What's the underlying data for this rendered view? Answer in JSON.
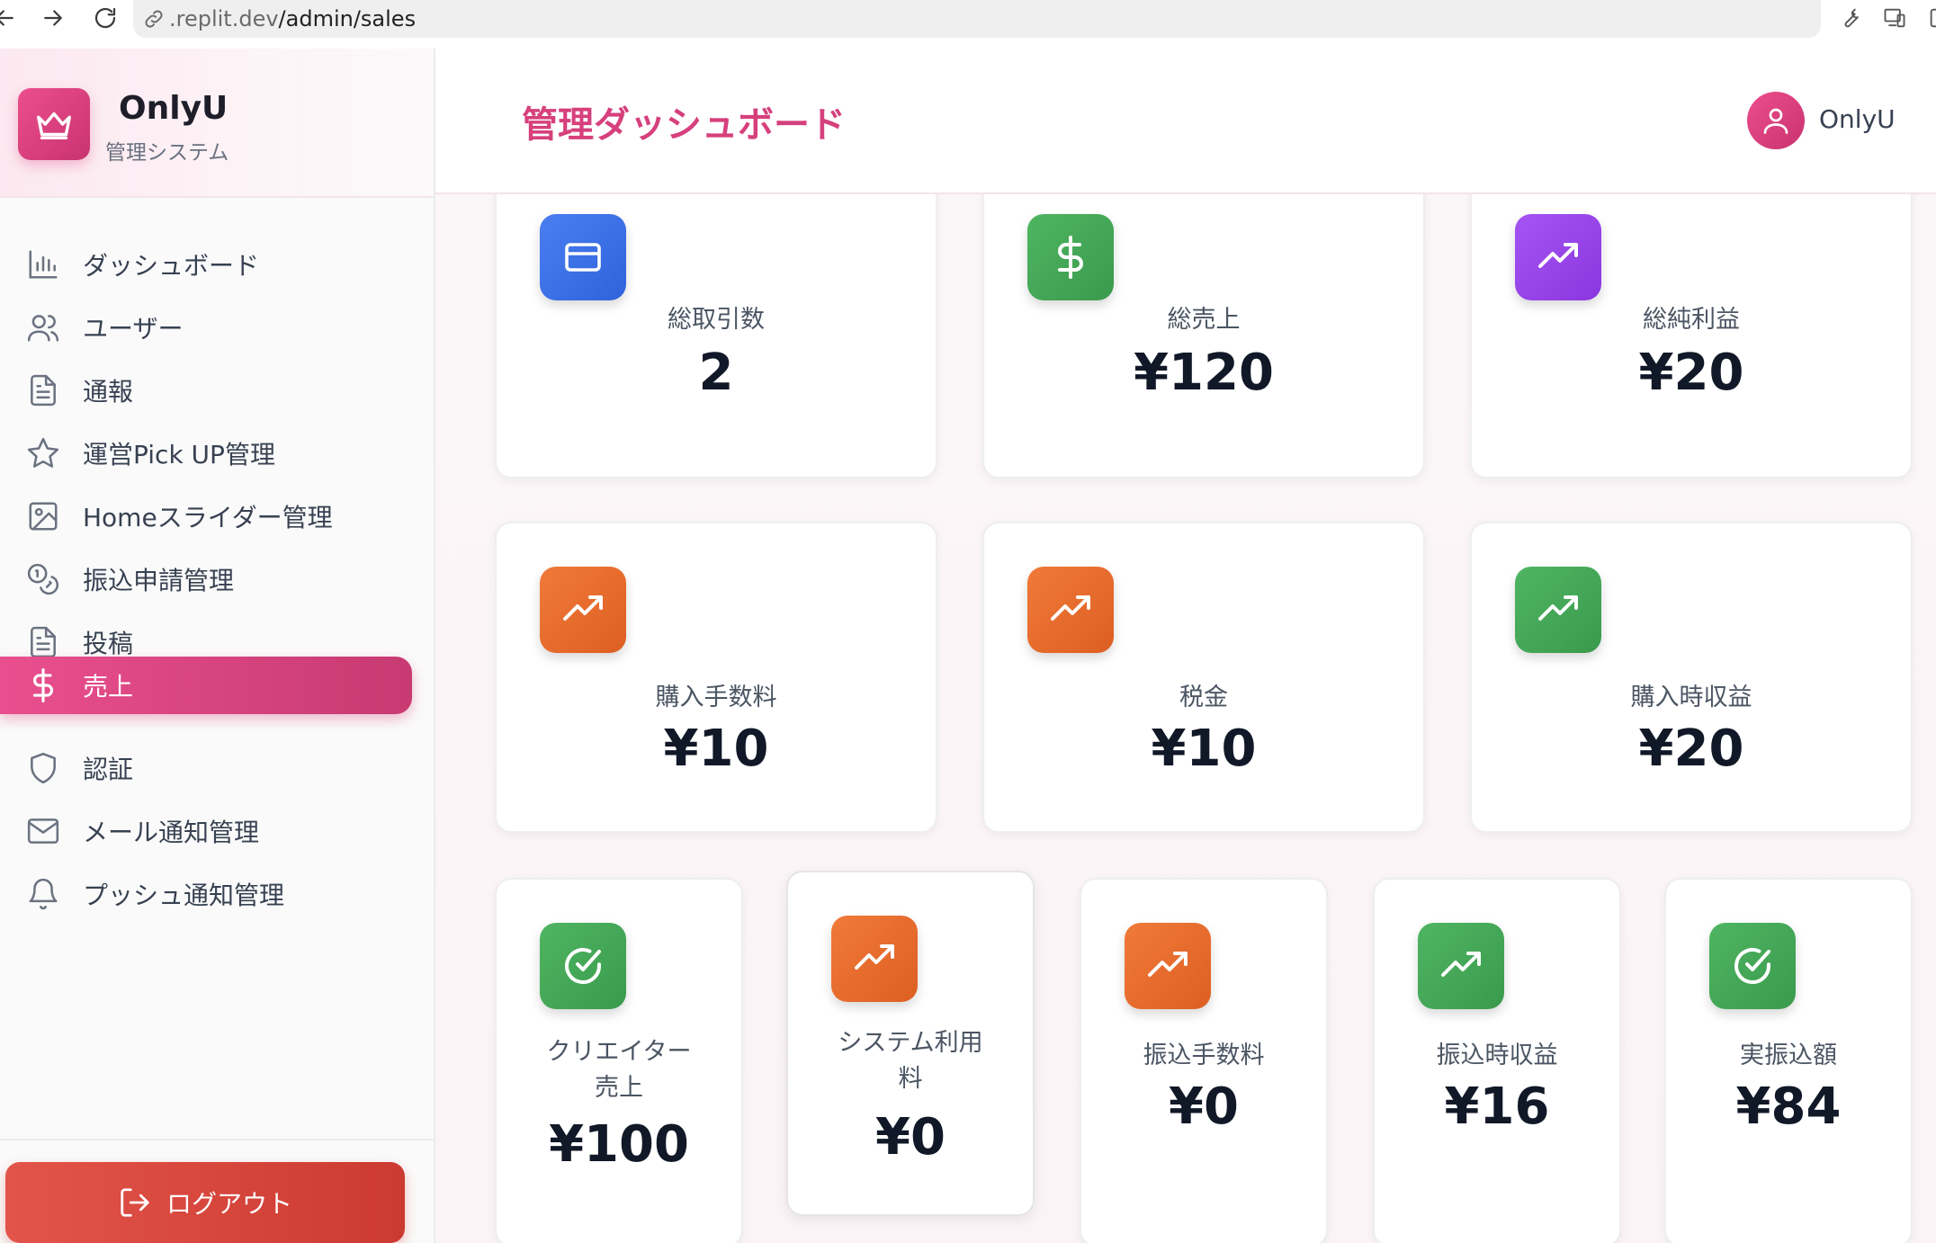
{
  "browser": {
    "url_prefix": ".replit.dev",
    "url_path": "/admin/sales"
  },
  "sidebar": {
    "brand_name": "OnlyU",
    "brand_sub": "管理システム",
    "items": [
      {
        "label": "ダッシュボード",
        "icon": "bar-chart-icon"
      },
      {
        "label": "ユーザー",
        "icon": "users-icon"
      },
      {
        "label": "通報",
        "icon": "file-text-icon"
      },
      {
        "label": "運営Pick UP管理",
        "icon": "star-icon"
      },
      {
        "label": "Homeスライダー管理",
        "icon": "image-icon"
      },
      {
        "label": "振込申請管理",
        "icon": "coins-icon"
      },
      {
        "label": "投稿",
        "icon": "file-text-icon"
      },
      {
        "label": "売上",
        "icon": "dollar-icon",
        "active": true
      },
      {
        "label": "認証",
        "icon": "shield-icon"
      },
      {
        "label": "メール通知管理",
        "icon": "mail-icon"
      },
      {
        "label": "プッシュ通知管理",
        "icon": "bell-icon"
      }
    ],
    "logout_label": "ログアウト"
  },
  "header": {
    "title": "管理ダッシュボード",
    "user_name": "OnlyU"
  },
  "cards_row1": [
    {
      "label": "総取引数",
      "value": "2",
      "icon": "credit-card-icon",
      "color": "#3b6fe6"
    },
    {
      "label": "総売上",
      "value": "¥120",
      "icon": "dollar-icon",
      "color": "#45a858"
    },
    {
      "label": "総純利益",
      "value": "¥20",
      "icon": "trending-up-icon",
      "color": "#9a47ea"
    }
  ],
  "cards_row2": [
    {
      "label": "購入手数料",
      "value": "¥10",
      "icon": "trending-up-icon",
      "color": "#e86c2d"
    },
    {
      "label": "税金",
      "value": "¥10",
      "icon": "trending-up-icon",
      "color": "#e86c2d"
    },
    {
      "label": "購入時収益",
      "value": "¥20",
      "icon": "trending-up-icon",
      "color": "#45a858"
    }
  ],
  "cards_row3": [
    {
      "label_line1": "クリエイター",
      "label_line2": "売上",
      "value": "¥100",
      "icon": "check-circle-icon",
      "color": "#45a858"
    },
    {
      "label_line1": "システム利用",
      "label_line2": "料",
      "value": "¥0",
      "icon": "trending-up-icon",
      "color": "#e86c2d"
    },
    {
      "label": "振込手数料",
      "value": "¥0",
      "icon": "trending-up-icon",
      "color": "#e86c2d"
    },
    {
      "label": "振込時収益",
      "value": "¥16",
      "icon": "trending-up-icon",
      "color": "#45a858"
    },
    {
      "label": "実振込額",
      "value": "¥84",
      "icon": "check-circle-icon",
      "color": "#45a858"
    }
  ]
}
